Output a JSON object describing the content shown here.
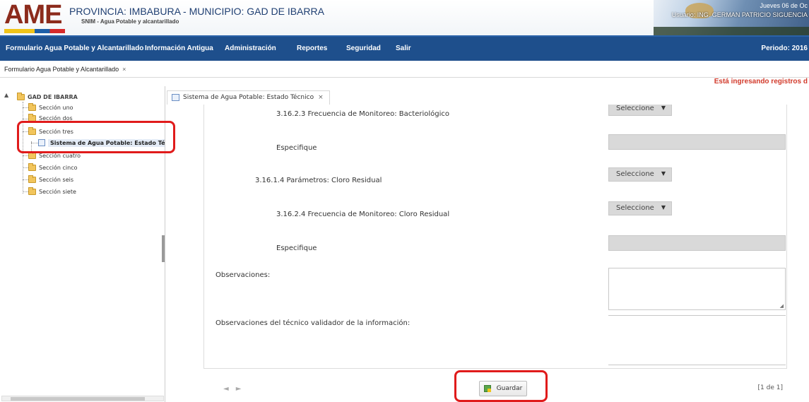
{
  "header": {
    "logo_text": "AME",
    "title": "PROVINCIA: IMBABURA - MUNICIPIO: GAD DE IBARRA",
    "subtitle": "SNIM - Agua Potable y alcantarillado",
    "date_text": "Jueves 06 de Oc",
    "user_text": "Usuario: ING. GERMAN PATRICIO SIGUENCIA"
  },
  "nav": {
    "items": [
      "Formulario Agua Potable y Alcantarillado",
      "Información Antigua",
      "Administración",
      "Reportes",
      "Seguridad",
      "Salir"
    ],
    "periodo": "Periodo: 2016"
  },
  "top_tab": {
    "label": "Formulario Agua Potable y Alcantarillado",
    "close": "×"
  },
  "notice": "Está ingresando registros d",
  "tree": {
    "root": "GAD DE IBARRA",
    "items": [
      "Sección uno",
      "Sección dos",
      "Sección tres",
      "Sistema de Agua Potable: Estado Técni",
      "Sección cuatro",
      "Sección cinco",
      "Sección seis",
      "Sección siete"
    ]
  },
  "inner_tab": {
    "label": "Sistema de Agua Potable: Estado Técnico",
    "close": "×"
  },
  "form": {
    "rows": [
      {
        "label": "3.16.2.3 Frecuencia de Monitoreo: Bacteriológico",
        "control": "select",
        "value": "Seleccione"
      },
      {
        "label": "Especifique",
        "control": "text",
        "value": ""
      },
      {
        "label": "3.16.1.4 Parámetros: Cloro Residual",
        "control": "select",
        "value": "Seleccione"
      },
      {
        "label": "3.16.2.4 Frecuencia de Monitoreo: Cloro Residual",
        "control": "select",
        "value": "Seleccione"
      },
      {
        "label": "Especifique",
        "control": "text",
        "value": ""
      }
    ],
    "observaciones_label": "Observaciones:",
    "observaciones_tecnico_label": "Observaciones del técnico validador de la información:"
  },
  "footer": {
    "prev": "◄",
    "next": "►",
    "save_label": "Guardar",
    "pager": "[1 de 1]"
  },
  "colors": {
    "nav_bg": "#1e4f8c",
    "notice": "#d23a2b",
    "highlight": "#e01b1b"
  }
}
